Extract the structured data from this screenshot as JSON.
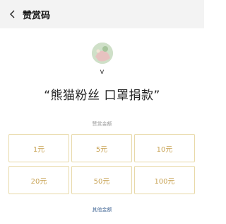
{
  "navbar": {
    "title": "赞赏码",
    "background": "#f3f3f3"
  },
  "profile": {
    "username": "v"
  },
  "campaign": {
    "title": "“熊猫粉丝 口罩捐款”"
  },
  "amount_section": {
    "caption": "赞赏金额",
    "options": [
      "1元",
      "5元",
      "10元",
      "20元",
      "50元",
      "100元"
    ],
    "other_label": "其他金额"
  },
  "colors": {
    "accent_gold": "#c8a355",
    "border_gold": "#e8d9a8",
    "link_blue": "#4a6d9a"
  }
}
